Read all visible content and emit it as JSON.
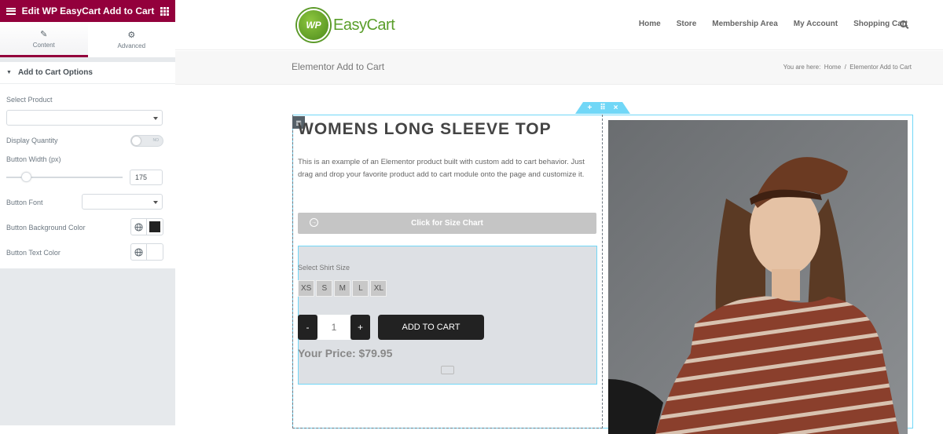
{
  "panel": {
    "title": "Edit WP EasyCart Add to Cart",
    "tabs": [
      {
        "label": "Content",
        "icon": "pencil-icon"
      },
      {
        "label": "Advanced",
        "icon": "gear-icon"
      }
    ],
    "section_title": "Add to Cart Options",
    "controls": {
      "select_product": "Select Product",
      "display_quantity": "Display Quantity",
      "toggle_state": "NO",
      "button_width": "Button Width (px)",
      "button_width_value": "175",
      "button_width_fraction": 0.1,
      "button_font": "Button Font",
      "button_bg_color": "Button Background Color",
      "button_bg_color_value": "#222222",
      "button_text_color": "Button Text Color",
      "button_text_color_value": "#ffffff"
    }
  },
  "site": {
    "logo_badge": "WP",
    "logo_text": "EasyCart",
    "nav": [
      "Home",
      "Store",
      "Membership Area",
      "My Account",
      "Shopping Cart"
    ],
    "page_title": "Elementor Add to Cart",
    "breadcrumb": {
      "prefix": "You are here:",
      "home": "Home",
      "separator": "/",
      "current": "Elementor Add to Cart"
    }
  },
  "product": {
    "title": "WOMENS LONG SLEEVE TOP",
    "description": "This is an example of an Elementor product built with custom add to cart behavior. Just drag and drop your favorite product add to cart module onto the page and customize it.",
    "size_chart_button": "Click for Size Chart",
    "size_label": "Select Shirt Size",
    "sizes": [
      "XS",
      "S",
      "M",
      "L",
      "XL"
    ],
    "qty_minus": "-",
    "qty_value": "1",
    "qty_plus": "+",
    "add_to_cart": "ADD TO CART",
    "price": "Your Price: $79.95"
  },
  "colors": {
    "panel_accent": "#93003c",
    "editor_outline": "#71d7f7",
    "brand_green": "#5a9e2a"
  }
}
